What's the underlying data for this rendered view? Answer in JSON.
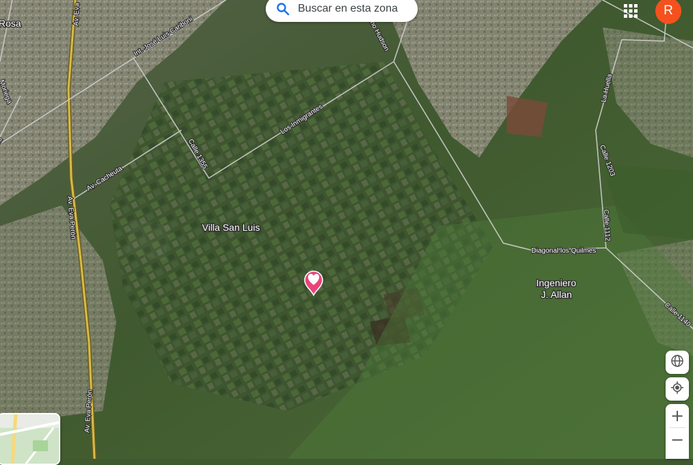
{
  "search": {
    "label": "Buscar en esta zona",
    "icon": "search-icon"
  },
  "account": {
    "initial": "R",
    "color": "#f4511e"
  },
  "apps": {
    "icon": "apps-grid-icon"
  },
  "places": {
    "rosa": "Rosa",
    "villa_san_luis": "Villa San Luis",
    "ingeniero_line1": "Ingeniero",
    "ingeniero_line2": "J. Allan"
  },
  "roads": {
    "av_eva_top": "Av. Eva",
    "av_eva_peron_1": "Av. Eva Perón",
    "av_eva_peron_2": "Av. Eva Perón",
    "caribon": "Int. José Luis Cariboni",
    "hudson": "mo Hudson",
    "los_inmigrantes": "Los Inmigrantes",
    "calle_1355": "Calle 1355",
    "av_cacheuta": "Av. Cacheuta",
    "la_huella": "La Huella",
    "calle_1203": "Calle 1203",
    "calle_1112": "Calle 1112",
    "diagonal_quilmes": "Diagonal los Quilmes",
    "calle_1140": "Calle 1140",
    "moriega": "Moriega",
    "edge_left": "ni"
  },
  "pin": {
    "icon": "heart-pin-icon",
    "color": "#e8457a"
  },
  "controls": {
    "globe": "globe-icon",
    "location": "my-location-icon",
    "zoom_in": "+",
    "zoom_out": "−"
  },
  "colors": {
    "satellite_dark": "#3f5a2e",
    "urban": "#8d8a78",
    "road_major": "#d4b94a",
    "road_minor": "#c9c9c9"
  }
}
